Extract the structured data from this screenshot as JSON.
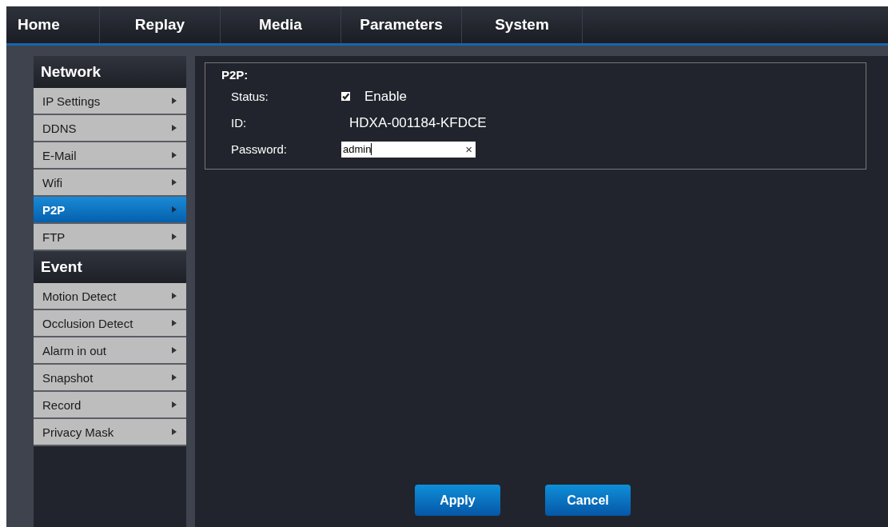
{
  "nav": [
    "Home",
    "Replay",
    "Media",
    "Parameters",
    "System"
  ],
  "sidebar": [
    {
      "title": "Network",
      "items": [
        {
          "label": "IP Settings",
          "selected": false
        },
        {
          "label": "DDNS",
          "selected": false
        },
        {
          "label": "E-Mail",
          "selected": false
        },
        {
          "label": "Wifi",
          "selected": false
        },
        {
          "label": "P2P",
          "selected": true
        },
        {
          "label": "FTP",
          "selected": false
        }
      ]
    },
    {
      "title": "Event",
      "items": [
        {
          "label": "Motion Detect",
          "selected": false
        },
        {
          "label": "Occlusion Detect",
          "selected": false
        },
        {
          "label": "Alarm in out",
          "selected": false
        },
        {
          "label": "Snapshot",
          "selected": false
        },
        {
          "label": "Record",
          "selected": false
        },
        {
          "label": "Privacy Mask",
          "selected": false
        }
      ]
    }
  ],
  "panel": {
    "title": "P2P:",
    "status": {
      "label": "Status:",
      "checked": true,
      "text": "Enable"
    },
    "id": {
      "label": "ID:",
      "value": "HDXA-001184-KFDCE"
    },
    "password": {
      "label": "Password:",
      "value": "admin",
      "clear": "×"
    }
  },
  "buttons": [
    "Apply",
    "Cancel"
  ]
}
